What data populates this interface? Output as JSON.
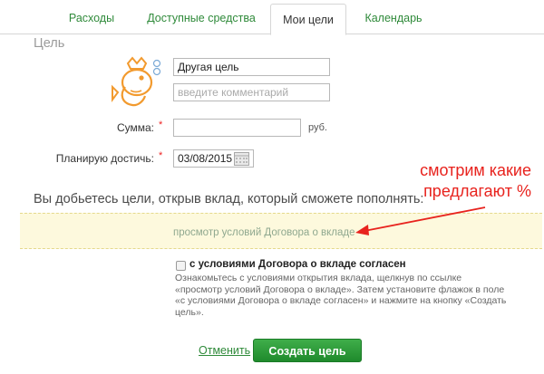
{
  "tabs": [
    {
      "label": "Расходы",
      "active": false
    },
    {
      "label": "Доступные средства",
      "active": false
    },
    {
      "label": "Мои цели",
      "active": true
    },
    {
      "label": "Календарь",
      "active": false
    }
  ],
  "section_title": "Цель",
  "goal": {
    "name_value": "Другая цель",
    "comment_placeholder": "введите комментарий",
    "icon": "fish-icon"
  },
  "form": {
    "amount_label": "Сумма:",
    "amount_value": "",
    "amount_unit": "руб.",
    "date_label": "Планирую достичь:",
    "date_value": "03/08/2015",
    "required_mark": "*"
  },
  "headline": "Вы добьетесь цели, открыв вклад, который сможете пополнять:",
  "notice_link": "просмотр условий Договора о вкладе",
  "annotation": {
    "line1": "смотрим какие",
    "line2": "предлагают %",
    "color": "#e8231e"
  },
  "agreement": {
    "checkbox_label": "с условиями Договора о вкладе согласен",
    "checked": false,
    "hint_lines": [
      "Ознакомьтесь с условиями открытия вклада, щелкнув по ссылке",
      "«просмотр условий Договора о вкладе». Затем установите флажок в поле",
      "«с условиями Договора о вкладе согласен» и нажмите на кнопку «Создать",
      "цель»."
    ]
  },
  "actions": {
    "cancel_label": "Отменить",
    "create_label": "Создать цель"
  },
  "colors": {
    "accent_green": "#2f8a3a",
    "button_green": "#1f8a2c",
    "notice_bg": "#fdf9dd"
  }
}
